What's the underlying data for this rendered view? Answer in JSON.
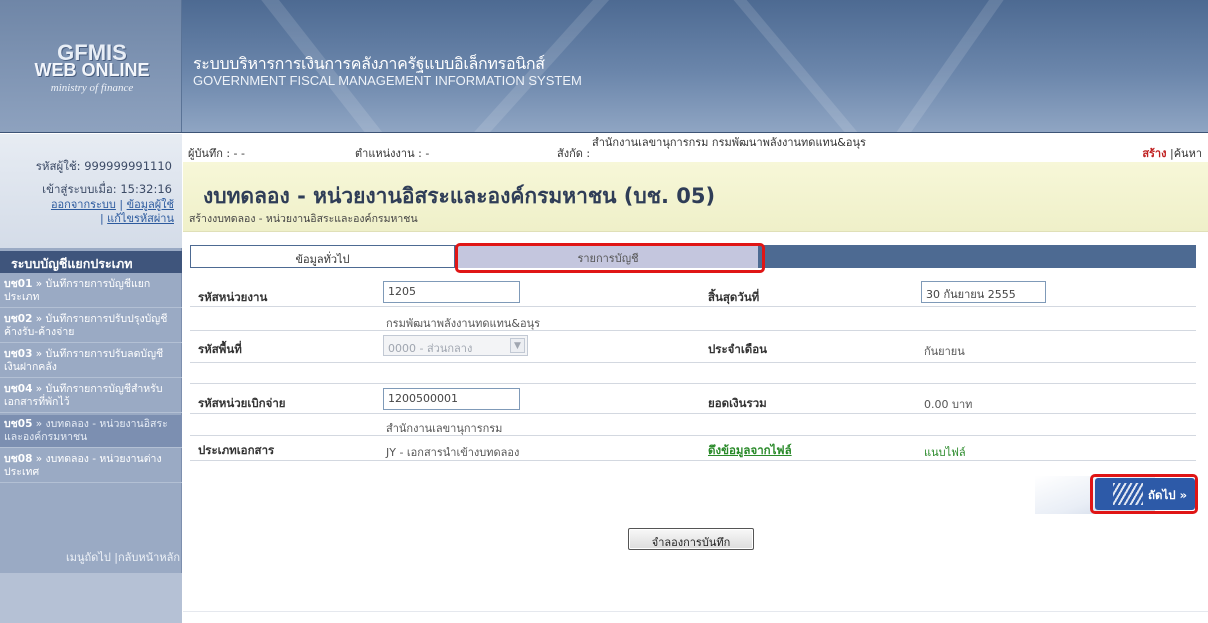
{
  "banner": {
    "logo_line1": "GFMIS",
    "logo_line2": "WEB ONLINE",
    "logo_line3": "ministry of finance",
    "title_th": "ระบบบริหารการเงินการคลังภาครัฐแบบอิเล็กทรอนิกส์",
    "title_en": "GOVERNMENT FISCAL MANAGEMENT INFORMATION SYSTEM"
  },
  "user": {
    "user_id": "รหัสผู้ใช้: 999999991110",
    "login_time": "เข้าสู่ระบบเมื่อ: 15:32:16",
    "logout": "ออกจากระบบ",
    "user_info": "ข้อมูลผู้ใช้",
    "change_password": "แก้ไขรหัสผ่าน"
  },
  "sidebar": {
    "heading": "ระบบบัญชีแยกประเภท",
    "items": [
      {
        "code": "บช01",
        "label": "» บันทึกรายการบัญชีแยกประเภท"
      },
      {
        "code": "บช02",
        "label": "» บันทึกรายการปรับปรุงบัญชีค้างรับ-ค้างจ่าย"
      },
      {
        "code": "บช03",
        "label": "» บันทึกรายการปรับลดบัญชีเงินฝากคลัง"
      },
      {
        "code": "บช04",
        "label": "» บันทึกรายการบัญชีสำหรับเอกสารที่พักไว้"
      },
      {
        "code": "บช05",
        "label": "» งบทดลอง - หน่วยงานอิสระและองค์กรมหาชน"
      },
      {
        "code": "บช08",
        "label": "» งบทดลอง - หน่วยงานต่างประเทศ"
      }
    ],
    "footer": "เมนูถัดไป |กลับหน้าหลัก"
  },
  "topbar": {
    "recorder": "ผู้บันทึก : - -",
    "position": "ตำแหน่งงาน : -",
    "affiliation_label": "สังกัด :",
    "affiliation_value": "สำนักงานเลขานุการกรม กรมพัฒนาพลังงานทดแทน&อนุร",
    "create": "สร้าง",
    "search": "|ค้นหา"
  },
  "page": {
    "title": "งบทดลอง - หน่วยงานอิสระและองค์กรมหาชน (บช. 05)",
    "subtitle": "สร้างงบทดลอง - หน่วยงานอิสระและองค์กรมหาชน"
  },
  "tabs": {
    "general": "ข้อมูลทั่วไป",
    "accounts": "รายการบัญชี"
  },
  "form": {
    "agency_code_label": "รหัสหน่วยงาน",
    "agency_code_value": "1205",
    "agency_name": "กรมพัฒนาพลังงานทดแทน&อนุร",
    "end_date_label": "สิ้นสุดวันที่",
    "end_date_value": "30 กันยายน 2555",
    "area_code_label": "รหัสพื้นที่",
    "area_code_value": "0000 - ส่วนกลาง",
    "month_label": "ประจำเดือน",
    "month_value": "กันยายน",
    "disbursing_unit_label": "รหัสหน่วยเบิกจ่าย",
    "disbursing_unit_value": "1200500001",
    "disbursing_unit_name": "สำนักงานเลขานุการกรม",
    "total_label": "ยอดเงินรวม",
    "total_value": "0.00 บาท",
    "doc_type_label": "ประเภทเอกสาร",
    "doc_type_value": "JY - เอกสารนำเข้างบทดลอง",
    "import_file": "ดึงข้อมูลจากไฟล์",
    "attach_file": "แนบไฟล์"
  },
  "buttons": {
    "next": "ถัดไป »",
    "simulate_save": "จำลองการบันทึก"
  },
  "colors": {
    "header_blue": "#4d6a92",
    "title_bg": "#f3f3d0",
    "highlight_red": "#e01515",
    "link_green": "#2a8a2a"
  }
}
